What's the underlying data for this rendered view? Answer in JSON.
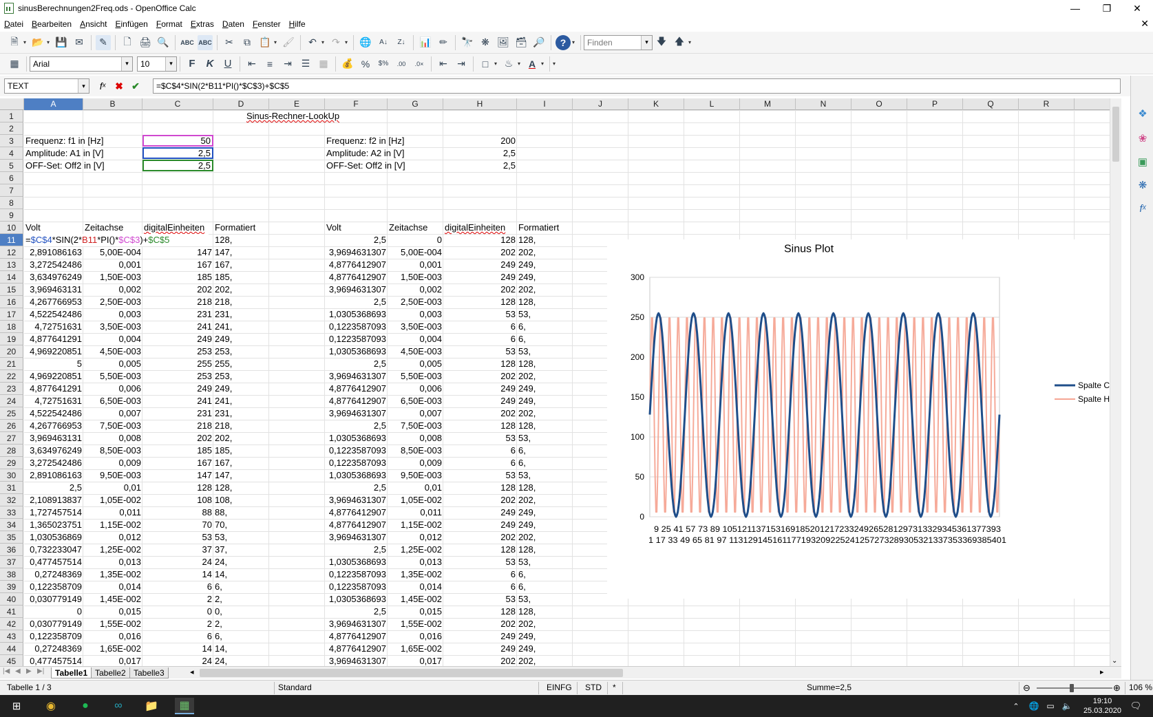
{
  "window": {
    "title": "sinusBerechnungen2Freq.ods - OpenOffice Calc"
  },
  "menu": [
    "Datei",
    "Bearbeiten",
    "Ansicht",
    "Einfügen",
    "Format",
    "Extras",
    "Daten",
    "Fenster",
    "Hilfe"
  ],
  "toolbar": {
    "find_placeholder": "Finden",
    "font_name": "Arial",
    "font_size": "10"
  },
  "formula_bar": {
    "name_box": "TEXT",
    "formula": "=$C$4*SIN(2*B11*PI()*$C$3)+$C$5"
  },
  "columns": [
    "A",
    "B",
    "C",
    "D",
    "E",
    "F",
    "G",
    "H",
    "I",
    "J",
    "K",
    "L",
    "M",
    "N",
    "O",
    "P",
    "Q",
    "R"
  ],
  "selected_cell": {
    "col": "A",
    "row": 11
  },
  "sheet": {
    "title": "Sinus-Rechner-LookUp",
    "params_left": [
      {
        "label": "Frequenz: f1 in [Hz]",
        "value": "50"
      },
      {
        "label": "Amplitude: A1 in [V]",
        "value": "2,5"
      },
      {
        "label": "OFF-Set: Off2 in [V]",
        "value": "2,5"
      }
    ],
    "params_right": [
      {
        "label": "Frequenz: f2 in [Hz]",
        "value": "200"
      },
      {
        "label": "Amplitude: A2 in [V]",
        "value": "2,5"
      },
      {
        "label": "OFF-Set: Off2 in [V]",
        "value": "2,5"
      }
    ],
    "headers_left": [
      "Volt",
      "Zeitachse",
      "digitalEinheiten",
      "Formatiert"
    ],
    "headers_right": [
      "Volt",
      "Zeitachse",
      "digitalEinheiten",
      "Formatiert"
    ],
    "edit_row": {
      "formula_parts": [
        "=",
        "$C$4",
        "*SIN(2*",
        "B11",
        "*PI()*",
        "$C$3",
        ")+",
        "$C$5"
      ],
      "formatted_left": "128,",
      "volt_right": "2,5",
      "zeit_right": "0",
      "digital_right": "128",
      "formatted_right": "128,"
    },
    "rows": [
      [
        "2,891086163",
        "5,00E-004",
        "147",
        "147,",
        "3,9694631307",
        "5,00E-004",
        "202",
        "202,"
      ],
      [
        "3,272542486",
        "0,001",
        "167",
        "167,",
        "4,8776412907",
        "0,001",
        "249",
        "249,"
      ],
      [
        "3,634976249",
        "1,50E-003",
        "185",
        "185,",
        "4,8776412907",
        "1,50E-003",
        "249",
        "249,"
      ],
      [
        "3,969463131",
        "0,002",
        "202",
        "202,",
        "3,9694631307",
        "0,002",
        "202",
        "202,"
      ],
      [
        "4,267766953",
        "2,50E-003",
        "218",
        "218,",
        "2,5",
        "2,50E-003",
        "128",
        "128,"
      ],
      [
        "4,522542486",
        "0,003",
        "231",
        "231,",
        "1,0305368693",
        "0,003",
        "53",
        "53,"
      ],
      [
        "4,72751631",
        "3,50E-003",
        "241",
        "241,",
        "0,1223587093",
        "3,50E-003",
        "6",
        "6,"
      ],
      [
        "4,877641291",
        "0,004",
        "249",
        "249,",
        "0,1223587093",
        "0,004",
        "6",
        "6,"
      ],
      [
        "4,969220851",
        "4,50E-003",
        "253",
        "253,",
        "1,0305368693",
        "4,50E-003",
        "53",
        "53,"
      ],
      [
        "5",
        "0,005",
        "255",
        "255,",
        "2,5",
        "0,005",
        "128",
        "128,"
      ],
      [
        "4,969220851",
        "5,50E-003",
        "253",
        "253,",
        "3,9694631307",
        "5,50E-003",
        "202",
        "202,"
      ],
      [
        "4,877641291",
        "0,006",
        "249",
        "249,",
        "4,8776412907",
        "0,006",
        "249",
        "249,"
      ],
      [
        "4,72751631",
        "6,50E-003",
        "241",
        "241,",
        "4,8776412907",
        "6,50E-003",
        "249",
        "249,"
      ],
      [
        "4,522542486",
        "0,007",
        "231",
        "231,",
        "3,9694631307",
        "0,007",
        "202",
        "202,"
      ],
      [
        "4,267766953",
        "7,50E-003",
        "218",
        "218,",
        "2,5",
        "7,50E-003",
        "128",
        "128,"
      ],
      [
        "3,969463131",
        "0,008",
        "202",
        "202,",
        "1,0305368693",
        "0,008",
        "53",
        "53,"
      ],
      [
        "3,634976249",
        "8,50E-003",
        "185",
        "185,",
        "0,1223587093",
        "8,50E-003",
        "6",
        "6,"
      ],
      [
        "3,272542486",
        "0,009",
        "167",
        "167,",
        "0,1223587093",
        "0,009",
        "6",
        "6,"
      ],
      [
        "2,891086163",
        "9,50E-003",
        "147",
        "147,",
        "1,0305368693",
        "9,50E-003",
        "53",
        "53,"
      ],
      [
        "2,5",
        "0,01",
        "128",
        "128,",
        "2,5",
        "0,01",
        "128",
        "128,"
      ],
      [
        "2,108913837",
        "1,05E-002",
        "108",
        "108,",
        "3,9694631307",
        "1,05E-002",
        "202",
        "202,"
      ],
      [
        "1,727457514",
        "0,011",
        "88",
        "88,",
        "4,8776412907",
        "0,011",
        "249",
        "249,"
      ],
      [
        "1,365023751",
        "1,15E-002",
        "70",
        "70,",
        "4,8776412907",
        "1,15E-002",
        "249",
        "249,"
      ],
      [
        "1,030536869",
        "0,012",
        "53",
        "53,",
        "3,9694631307",
        "0,012",
        "202",
        "202,"
      ],
      [
        "0,732233047",
        "1,25E-002",
        "37",
        "37,",
        "2,5",
        "1,25E-002",
        "128",
        "128,"
      ],
      [
        "0,477457514",
        "0,013",
        "24",
        "24,",
        "1,0305368693",
        "0,013",
        "53",
        "53,"
      ],
      [
        "0,27248369",
        "1,35E-002",
        "14",
        "14,",
        "0,1223587093",
        "1,35E-002",
        "6",
        "6,"
      ],
      [
        "0,122358709",
        "0,014",
        "6",
        "6,",
        "0,1223587093",
        "0,014",
        "6",
        "6,"
      ],
      [
        "0,030779149",
        "1,45E-002",
        "2",
        "2,",
        "1,0305368693",
        "1,45E-002",
        "53",
        "53,"
      ],
      [
        "0",
        "0,015",
        "0",
        "0,",
        "2,5",
        "0,015",
        "128",
        "128,"
      ],
      [
        "0,030779149",
        "1,55E-002",
        "2",
        "2,",
        "3,9694631307",
        "1,55E-002",
        "202",
        "202,"
      ],
      [
        "0,122358709",
        "0,016",
        "6",
        "6,",
        "4,8776412907",
        "0,016",
        "249",
        "249,"
      ],
      [
        "0,27248369",
        "1,65E-002",
        "14",
        "14,",
        "4,8776412907",
        "1,65E-002",
        "249",
        "249,"
      ],
      [
        "0,477457514",
        "0,017",
        "24",
        "24,",
        "3,9694631307",
        "0,017",
        "202",
        "202,"
      ]
    ]
  },
  "chart_data": {
    "type": "line",
    "title": "Sinus Plot",
    "ylim": [
      0,
      300
    ],
    "yticks": [
      "0",
      "50",
      "100",
      "150",
      "200",
      "250",
      "300"
    ],
    "xticks_row1": "9  25  41  57  73  89 105121137153169185201217233249265281297313329345361377393",
    "xticks_row2": "1  17  33  49  65  81  97 113129145161177193209225241257273289305321337353369385401",
    "x_count": 401,
    "legend_position": "right",
    "series": [
      {
        "name": "Spalte C",
        "color": "#1f4e8a",
        "frequency_hz": 50,
        "amplitude": 127.5,
        "offset": 127.5
      },
      {
        "name": "Spalte H",
        "color": "#f5a593",
        "frequency_hz": 200,
        "amplitude": 127.5,
        "offset": 127.5
      }
    ]
  },
  "sheet_tabs": [
    "Tabelle1",
    "Tabelle2",
    "Tabelle3"
  ],
  "status": {
    "sheet": "Tabelle 1 / 3",
    "style": "Standard",
    "mode": "EINFG",
    "sel": "STD",
    "modified": "*",
    "sum": "Summe=2,5",
    "zoom": "106 %"
  },
  "taskbar": {
    "time": "19:10",
    "date": "25.03.2020"
  }
}
